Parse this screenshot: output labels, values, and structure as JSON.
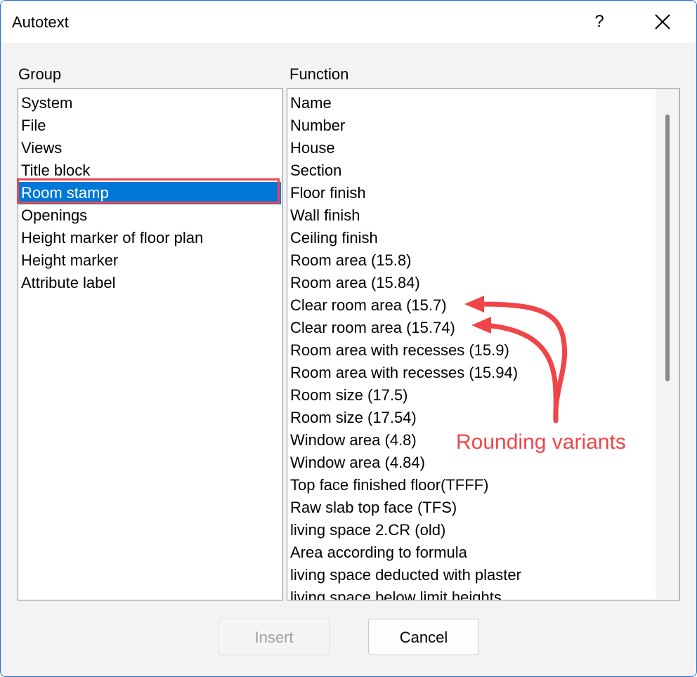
{
  "window": {
    "title": "Autotext",
    "help_label": "?"
  },
  "group": {
    "label": "Group",
    "items": [
      "System",
      "File",
      "Views",
      "Title block",
      "Room stamp",
      "Openings",
      "Height marker of floor plan",
      "Height marker",
      "Attribute label"
    ],
    "selected_index": 4
  },
  "function": {
    "label": "Function",
    "items": [
      "Name",
      "Number",
      "House",
      "Section",
      "Floor finish",
      "Wall finish",
      "Ceiling finish",
      "Room area (15.8)",
      "Room area (15.84)",
      "Clear room area (15.7)",
      "Clear room area (15.74)",
      "Room area with recesses (15.9)",
      "Room area with recesses (15.94)",
      "Room size (17.5)",
      "Room size (17.54)",
      "Window area (4.8)",
      "Window area (4.84)",
      "Top face finished floor(TFFF)",
      "Raw slab top face (TFS)",
      "living space 2.CR (old)",
      "Area according to formula",
      "living space deducted with plaster",
      "living space below limit heights"
    ]
  },
  "annotation": {
    "text": "Rounding variants",
    "color": "#f04548",
    "highlight_color": "#e8474f"
  },
  "buttons": {
    "insert": "Insert",
    "cancel": "Cancel"
  },
  "colors": {
    "selection": "#0078d7",
    "window_border": "#1f6fd0"
  }
}
